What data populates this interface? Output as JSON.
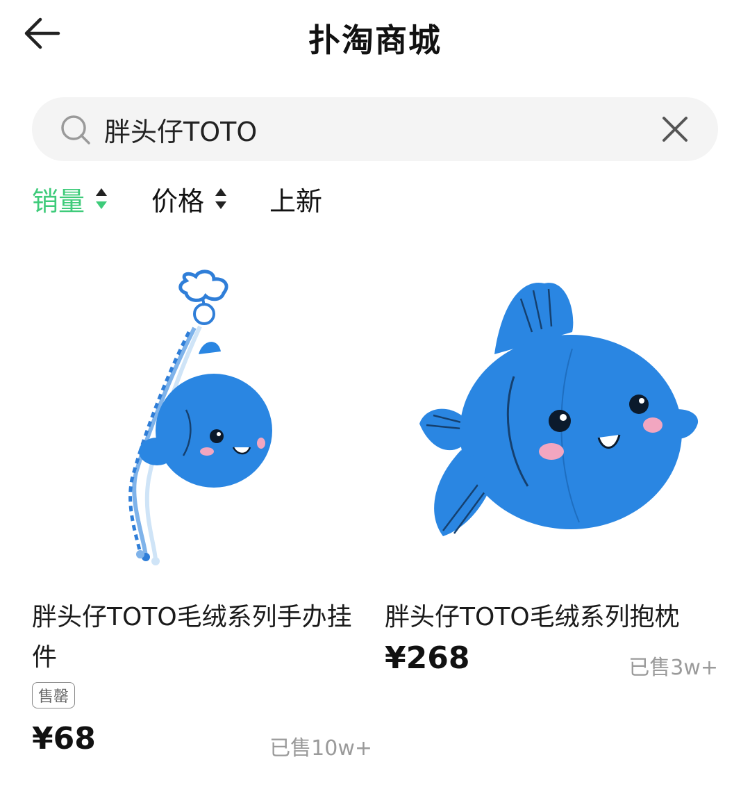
{
  "header": {
    "title": "扑淘商城"
  },
  "search": {
    "value": "胖头仔TOTO"
  },
  "sort": {
    "items": [
      {
        "label": "销量",
        "active": true
      },
      {
        "label": "价格",
        "active": false
      },
      {
        "label": "上新",
        "active": false
      }
    ],
    "accent_color": "#3ecb7a"
  },
  "products": [
    {
      "title": "胖头仔TOTO毛绒系列手办挂件",
      "tag": "售罄",
      "price": "¥68",
      "sold": "已售10w+",
      "image_icon": "blue-fish-plush-keychain"
    },
    {
      "title": "胖头仔TOTO毛绒系列抱枕",
      "price": "¥268",
      "sold": "已售3w+",
      "image_icon": "blue-fish-plush-pillow"
    }
  ]
}
